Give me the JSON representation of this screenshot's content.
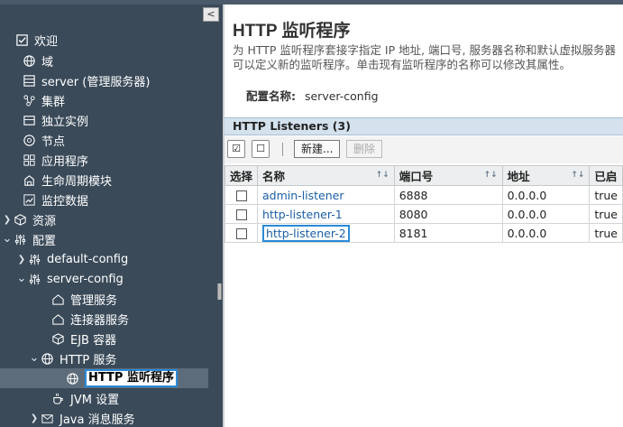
{
  "sidebar": {
    "collapse_glyph": "<",
    "items": [
      {
        "label": "欢迎",
        "icon": "checkbox-icon",
        "expander": ""
      },
      {
        "label": "域",
        "icon": "globe-icon",
        "expander": ""
      },
      {
        "label": "server (管理服务器)",
        "icon": "server-icon",
        "expander": ""
      },
      {
        "label": "集群",
        "icon": "cluster-icon",
        "expander": ""
      },
      {
        "label": "独立实例",
        "icon": "instance-icon",
        "expander": ""
      },
      {
        "label": "节点",
        "icon": "node-icon",
        "expander": ""
      },
      {
        "label": "应用程序",
        "icon": "grid-icon",
        "expander": ""
      },
      {
        "label": "生命周期模块",
        "icon": "puzzle-icon",
        "expander": ""
      },
      {
        "label": "监控数据",
        "icon": "chart-icon",
        "expander": ""
      },
      {
        "label": "资源",
        "icon": "cube-icon",
        "expander": ">"
      },
      {
        "label": "配置",
        "icon": "sliders-icon",
        "expander": "v"
      },
      {
        "label": "default-config",
        "icon": "sliders-icon",
        "expander": ">"
      },
      {
        "label": "server-config",
        "icon": "sliders-icon",
        "expander": "v"
      },
      {
        "label": "管理服务",
        "icon": "house-icon",
        "expander": ""
      },
      {
        "label": "连接器服务",
        "icon": "house-icon",
        "expander": ""
      },
      {
        "label": "EJB 容器",
        "icon": "cube-icon",
        "expander": ""
      },
      {
        "label": "HTTP 服务",
        "icon": "globe-icon",
        "expander": "v"
      },
      {
        "label": "HTTP 监听程序",
        "icon": "globe-icon",
        "expander": ""
      },
      {
        "label": "JVM 设置",
        "icon": "coffee-icon",
        "expander": ""
      },
      {
        "label": "Java 消息服务",
        "icon": "envelope-icon",
        "expander": ">"
      }
    ]
  },
  "main": {
    "title": "HTTP 监听程序",
    "description_line1": "为 HTTP 监听程序套接字指定 IP 地址, 端口号, 服务器名称和默认虚拟服务器",
    "description_line2": "可以定义新的监听程序。单击现有监听程序的名称可以修改其属性。",
    "config_label": "配置名称:",
    "config_value": "server-config",
    "table_title": "HTTP Listeners (3)",
    "toolbar": {
      "select_all_glyph": "☑",
      "deselect_all_glyph": "☐",
      "new_label": "新建...",
      "delete_label": "删除"
    },
    "table": {
      "columns": [
        "选择",
        "名称",
        "端口号",
        "地址",
        "已启"
      ],
      "rows": [
        {
          "name": "admin-listener",
          "port": "6888",
          "address": "0.0.0.0",
          "enabled": "true"
        },
        {
          "name": "http-listener-1",
          "port": "8080",
          "address": "0.0.0.0",
          "enabled": "true"
        },
        {
          "name": "http-listener-2",
          "port": "8181",
          "address": "0.0.0.0",
          "enabled": "true"
        }
      ]
    }
  },
  "colors": {
    "sidebar_bg": "#3a4a59",
    "selection_border": "#2b8ad8",
    "link": "#1b5fa6",
    "table_header_bar": "#d4e2ee"
  }
}
